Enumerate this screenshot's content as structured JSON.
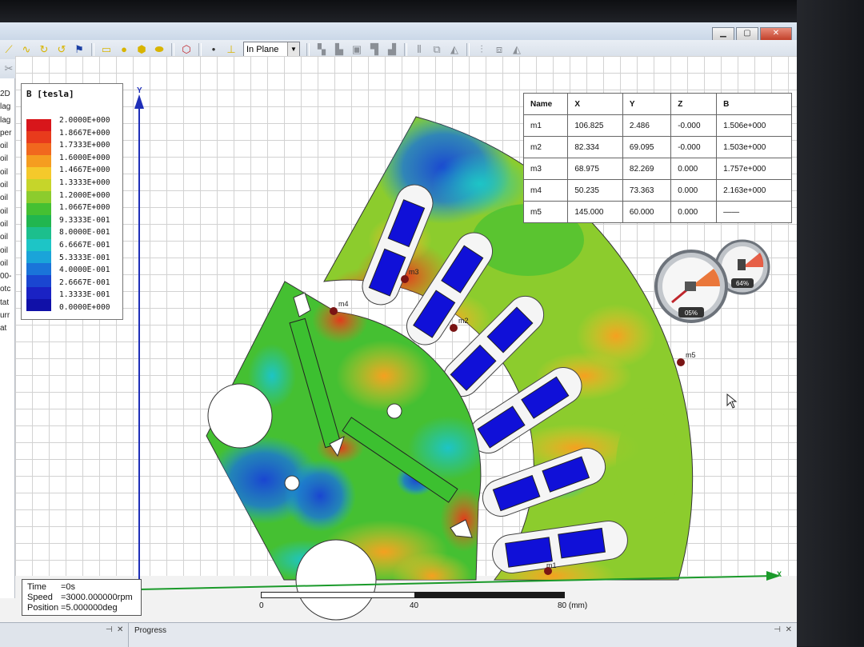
{
  "toolbar": {
    "plane_select": "In Plane"
  },
  "left_panel": {
    "items": [
      "2D",
      "lag",
      "lag",
      "per",
      "oil",
      "oil",
      "oil",
      "oil",
      "oil",
      "oil",
      "oil",
      "oil",
      "oil",
      "oil",
      "00-",
      "otc",
      "tat",
      "urr",
      "at"
    ]
  },
  "legend": {
    "title": "B [tesla]",
    "labels": [
      "2.0000E+000",
      "1.8667E+000",
      "1.7333E+000",
      "1.6000E+000",
      "1.4667E+000",
      "1.3333E+000",
      "1.2000E+000",
      "1.0667E+000",
      "9.3333E-001",
      "8.0000E-001",
      "6.6667E-001",
      "5.3333E-001",
      "4.0000E-001",
      "2.6667E-001",
      "1.3333E-001",
      "0.0000E+000"
    ],
    "colors": [
      "#d8161b",
      "#e83b1c",
      "#f1681e",
      "#f59d20",
      "#f5c92b",
      "#c6d52a",
      "#8ccc2d",
      "#45c032",
      "#21b64f",
      "#1cbf8d",
      "#1dc5c6",
      "#1aa4d9",
      "#1a74d9",
      "#1a46d1",
      "#1a22c4",
      "#1010a8"
    ]
  },
  "markers_table": {
    "headers": [
      "Name",
      "X",
      "Y",
      "Z",
      "B"
    ],
    "rows": [
      [
        "m1",
        "106.825",
        "2.486",
        "-0.000",
        "1.506e+000"
      ],
      [
        "m2",
        "82.334",
        "69.095",
        "-0.000",
        "1.503e+000"
      ],
      [
        "m3",
        "68.975",
        "82.269",
        "0.000",
        "1.757e+000"
      ],
      [
        "m4",
        "50.235",
        "73.363",
        "0.000",
        "2.163e+000"
      ],
      [
        "m5",
        "145.000",
        "60.000",
        "0.000",
        "——"
      ]
    ]
  },
  "markers": [
    "m1",
    "m2",
    "m3",
    "m4",
    "m5"
  ],
  "axes": {
    "y": "Y",
    "x": "X"
  },
  "status": {
    "time_key": "Time",
    "time_val": "=0s",
    "speed_key": "Speed",
    "speed_val": "=3000.000000rpm",
    "position_key": "Position",
    "position_val": "=5.000000deg"
  },
  "scale": {
    "labels": [
      "0",
      "40",
      "80 (mm)"
    ]
  },
  "gadget": {
    "cpu": "05%",
    "memory": "64%"
  },
  "bottom": {
    "panel_title": "Progress"
  }
}
